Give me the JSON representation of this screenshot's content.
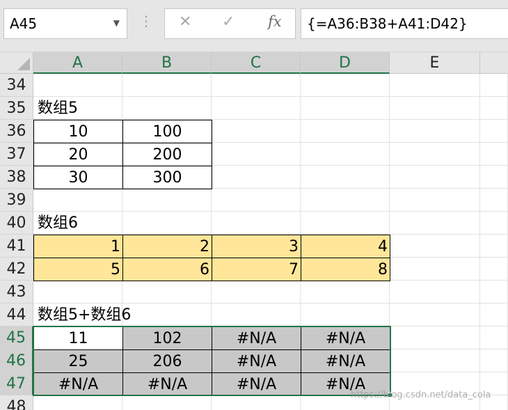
{
  "formula_bar": {
    "name_box": "A45",
    "cancel_icon": "✕",
    "enter_icon": "✓",
    "fx_label": "fx",
    "formula": "{=A36:B38+A41:D42}"
  },
  "columns": [
    "A",
    "B",
    "C",
    "D",
    "E"
  ],
  "rows": [
    "34",
    "35",
    "36",
    "37",
    "38",
    "39",
    "40",
    "41",
    "42",
    "43",
    "44",
    "45",
    "46",
    "47",
    "48"
  ],
  "labels": {
    "array5": "数组5",
    "array6": "数组6",
    "sum": "数组5+数组6"
  },
  "array5": [
    [
      "10",
      "100"
    ],
    [
      "20",
      "200"
    ],
    [
      "30",
      "300"
    ]
  ],
  "array6": [
    [
      "1",
      "2",
      "3",
      "4"
    ],
    [
      "5",
      "6",
      "7",
      "8"
    ]
  ],
  "result": [
    [
      "11",
      "102",
      "#N/A",
      "#N/A"
    ],
    [
      "25",
      "206",
      "#N/A",
      "#N/A"
    ],
    [
      "#N/A",
      "#N/A",
      "#N/A",
      "#N/A"
    ]
  ],
  "watermark": "https://blog.csdn.net/data_cola",
  "colors": {
    "accent": "#217346",
    "highlight_yellow": "#ffe699",
    "result_gray": "#c8c8c8"
  }
}
